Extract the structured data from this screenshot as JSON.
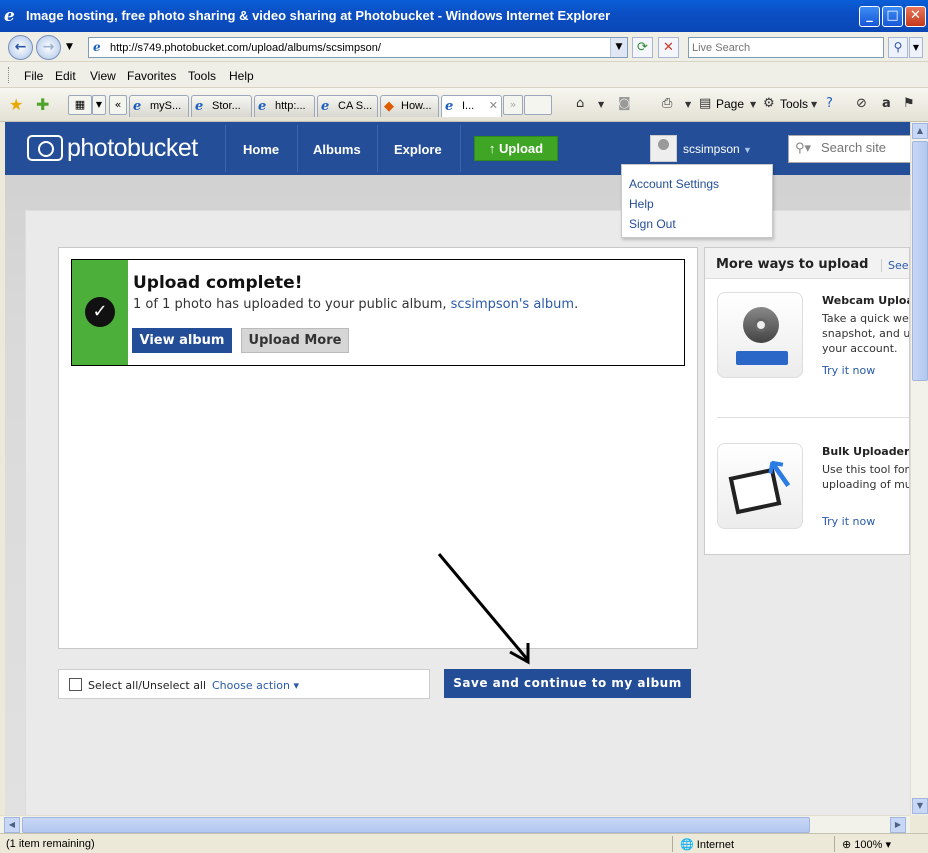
{
  "window": {
    "title": "Image hosting, free photo sharing & video sharing at Photobucket - Windows Internet Explorer",
    "minimize": "_",
    "maximize": "□",
    "close": "✕"
  },
  "browser": {
    "url": "http://s749.photobucket.com/upload/albums/scsimpson/",
    "search_placeholder": "Live Search",
    "menu": [
      "File",
      "Edit",
      "View",
      "Favorites",
      "Tools",
      "Help"
    ],
    "tabs": [
      {
        "label": "myS..."
      },
      {
        "label": "Stor..."
      },
      {
        "label": "http:..."
      },
      {
        "label": "CA S..."
      },
      {
        "label": "How..."
      },
      {
        "label": "I..."
      }
    ],
    "toolbar": {
      "page": "Page",
      "tools": "Tools"
    },
    "status": "(1 item remaining)",
    "zone": "Internet",
    "zoom": "100%"
  },
  "site": {
    "logo": "photobucket",
    "nav": [
      "Home",
      "Albums",
      "Explore"
    ],
    "upload_button": "Upload",
    "username": "scsimpson",
    "search_placeholder": "Search site",
    "account_menu": [
      "Account Settings",
      "Help",
      "Sign Out"
    ]
  },
  "upload": {
    "title": "Upload complete!",
    "message_prefix": "1 of 1 photo has uploaded to your public album, ",
    "album_link": "scsimpson's album",
    "message_suffix": ".",
    "view_album": "View album",
    "upload_more": "Upload More",
    "select_all": "Select all/Unselect all",
    "choose_action": "Choose action ▾",
    "save_continue": "Save and continue to my album"
  },
  "more_ways": {
    "title": "More ways to upload",
    "see": "See",
    "tools": [
      {
        "title": "Webcam Uploa",
        "desc": [
          "Take a quick web",
          "snapshot, and up",
          "your account."
        ],
        "link": "Try it now"
      },
      {
        "title": "Bulk Uploader",
        "desc": [
          "Use this tool for",
          "uploading of mu"
        ],
        "link": "Try it now"
      }
    ]
  }
}
